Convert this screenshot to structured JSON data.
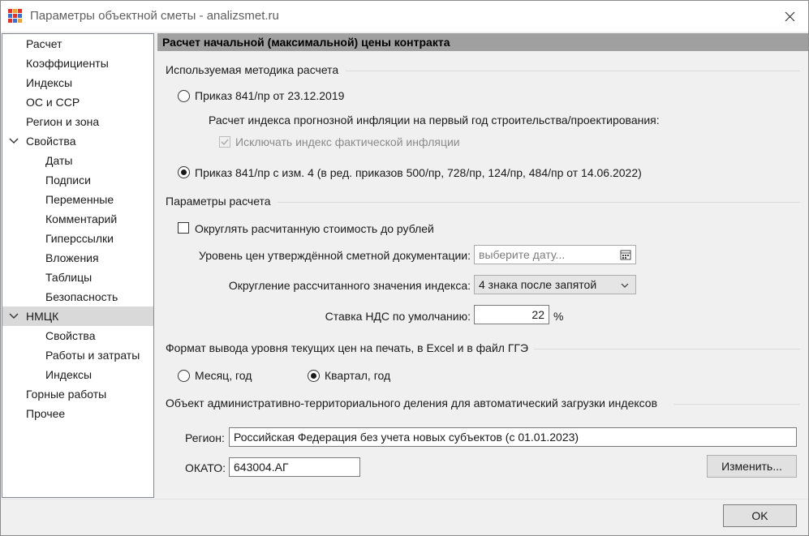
{
  "window": {
    "title": "Параметры объектной сметы - analizsmet.ru",
    "ok_label": "OK"
  },
  "tree": {
    "items": [
      {
        "label": "Расчет"
      },
      {
        "label": "Коэффициенты"
      },
      {
        "label": "Индексы"
      },
      {
        "label": "ОС и ССР"
      },
      {
        "label": "Регион и зона"
      },
      {
        "label": "Свойства"
      },
      {
        "label": "Даты"
      },
      {
        "label": "Подписи"
      },
      {
        "label": "Переменные"
      },
      {
        "label": "Комментарий"
      },
      {
        "label": "Гиперссылки"
      },
      {
        "label": "Вложения"
      },
      {
        "label": "Таблицы"
      },
      {
        "label": "Безопасность"
      },
      {
        "label": "НМЦК"
      },
      {
        "label": "Свойства"
      },
      {
        "label": "Работы и затраты"
      },
      {
        "label": "Индексы"
      },
      {
        "label": "Горные работы"
      },
      {
        "label": "Прочее"
      }
    ]
  },
  "panel": {
    "header": "Расчет начальной (максимальной) цены контракта",
    "method": {
      "title": "Используемая методика расчета",
      "option1": "Приказ 841/пр от 23.12.2019",
      "sub_label": "Расчет индекса прогнозной инфляции на первый год строительства/проектирования:",
      "exclude_label": "Исключать индекс фактической инфляции",
      "option2": "Приказ 841/пр с изм. 4 (в ред. приказов 500/пр, 728/пр, 124/пр, 484/пр от 14.06.2022)"
    },
    "params": {
      "title": "Параметры расчета",
      "round_label": "Округлять расчитанную стоимость до рублей",
      "price_level_label": "Уровень цен утверждённой сметной документации:",
      "date_placeholder": "выберите дату...",
      "rounding_label": "Округление рассчитанного значения индекса:",
      "rounding_value": "4 знака после запятой",
      "vat_label": "Ставка НДС по умолчанию:",
      "vat_value": "22",
      "vat_unit": "%"
    },
    "format": {
      "title": "Формат вывода уровня текущих цен на печать, в Excel и в файл ГГЭ",
      "option_month": "Месяц, год",
      "option_quarter": "Квартал, год"
    },
    "territory": {
      "title": "Объект административно-территориального деления для автоматический загрузки индексов",
      "region_label": "Регион:",
      "region_value": "Российская Федерация без учета новых субъектов (с 01.01.2023)",
      "okato_label": "ОКАТО:",
      "okato_value": "643004.АГ",
      "change_label": "Изменить..."
    }
  }
}
